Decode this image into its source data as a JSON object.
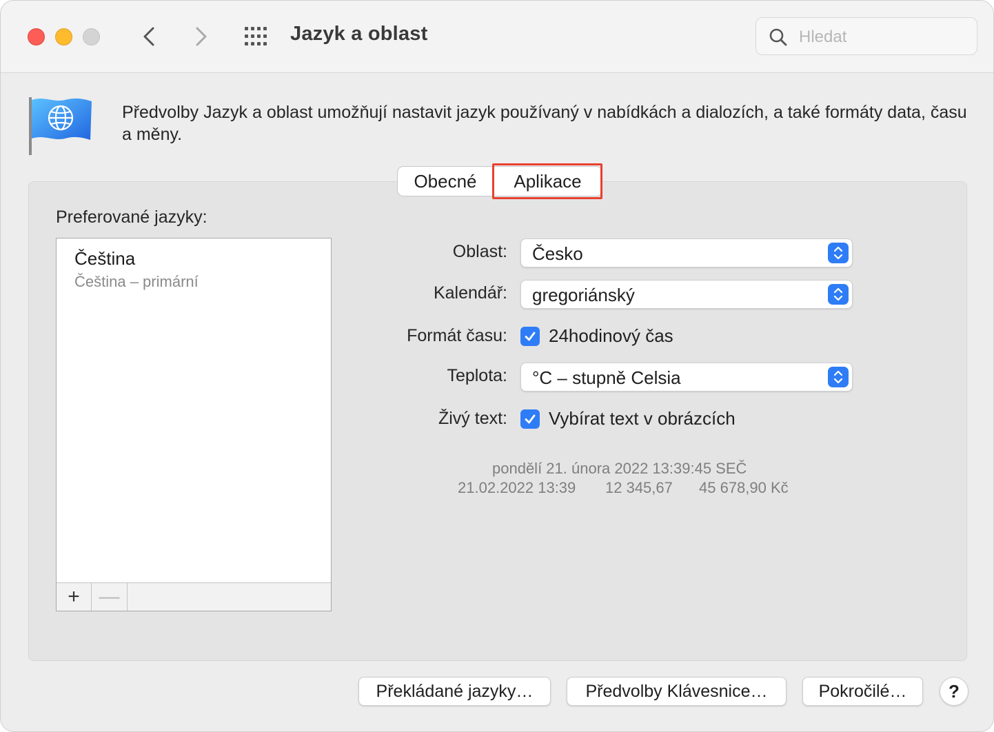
{
  "window": {
    "title": "Jazyk a oblast",
    "search_placeholder": "Hledat"
  },
  "icons": {
    "back": "chevron-left-icon",
    "forward": "chevron-right-icon",
    "show_all": "grid-icon",
    "search": "search-icon",
    "pane": "globe-flag-icon"
  },
  "description": "Předvolby Jazyk a oblast umožňují nastavit jazyk používaný v nabídkách a dialozích, a také formáty data, času a měny.",
  "tabs": [
    {
      "label": "Obecné",
      "selected": false
    },
    {
      "label": "Aplikace",
      "selected": false,
      "highlighted": true
    }
  ],
  "preferred_languages": {
    "label": "Preferované jazyky:",
    "items": [
      {
        "name": "Čeština",
        "detail": "Čeština – primární"
      }
    ],
    "add_label": "+",
    "remove_label": "—"
  },
  "settings": {
    "region": {
      "label": "Oblast:",
      "value": "Česko"
    },
    "calendar": {
      "label": "Kalendář:",
      "value": "gregoriánský"
    },
    "time_format": {
      "label": "Formát času:",
      "checkbox_label": "24hodinový čas",
      "checked": true
    },
    "temperature": {
      "label": "Teplota:",
      "value": "°C – stupně Celsia"
    },
    "live_text": {
      "label": "Živý text:",
      "checkbox_label": "Vybírat text v obrázcích",
      "checked": true
    }
  },
  "sample": {
    "long_date": "pondělí 21. února 2022 13:39:45 SEČ",
    "short_date": "21.02.2022 13:39",
    "number": "12 345,67",
    "currency": "45 678,90 Kč"
  },
  "buttons": {
    "translated_languages": "Překládané jazyky…",
    "keyboard_prefs": "Předvolby Klávesnice…",
    "advanced": "Pokročilé…",
    "help": "?"
  },
  "colors": {
    "accent": "#2f7df6",
    "highlight_frame": "#e8402f",
    "close": "#fd5d57",
    "minimize": "#febb2e"
  }
}
